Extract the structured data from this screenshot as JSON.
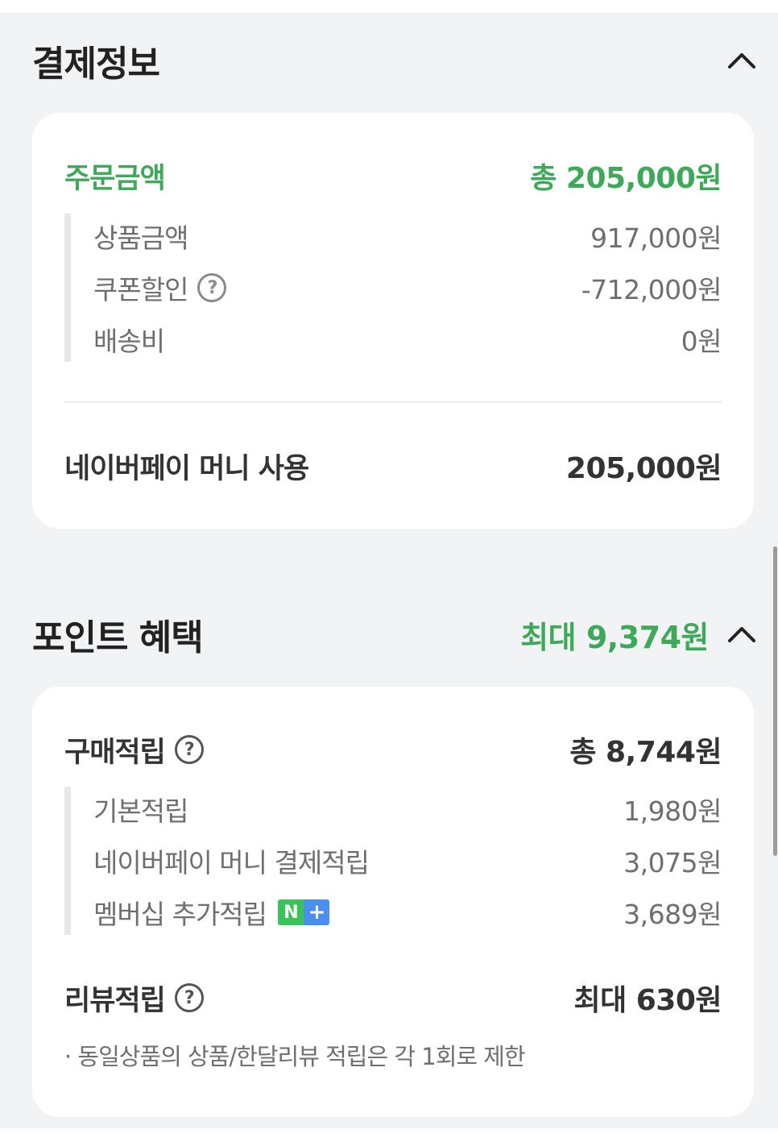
{
  "payment_section": {
    "title": "결제정보",
    "order_amount": {
      "label": "주문금액",
      "value": "총 205,000원",
      "items": [
        {
          "label": "상품금액",
          "value": "917,000원"
        },
        {
          "label": "쿠폰할인",
          "value": "-712,000원",
          "has_help": true
        },
        {
          "label": "배송비",
          "value": "0원"
        }
      ]
    },
    "naverpay_money": {
      "label": "네이버페이 머니 사용",
      "value": "205,000원"
    }
  },
  "points_section": {
    "title": "포인트 혜택",
    "max_benefit": "최대 9,374원",
    "purchase_reward": {
      "label": "구매적립",
      "value": "총 8,744원",
      "items": [
        {
          "label": "기본적립",
          "value": "1,980원"
        },
        {
          "label": "네이버페이 머니 결제적립",
          "value": "3,075원"
        },
        {
          "label": "멤버십 추가적립",
          "value": "3,689원",
          "badge": {
            "left": "N",
            "right": "+"
          }
        }
      ]
    },
    "review_reward": {
      "label": "리뷰적립",
      "value": "최대 630원"
    },
    "note": "· 동일상품의 상품/한달리뷰 적립은 각 1회로 제한"
  },
  "icons": {
    "collapse": "chevron-up-icon",
    "help": "question-circle-icon"
  },
  "colors": {
    "accent_green": "#3fa85b",
    "background": "#f2f3f5",
    "card": "#ffffff",
    "badge_green": "#39c35a",
    "badge_blue": "#4a8ef0"
  }
}
